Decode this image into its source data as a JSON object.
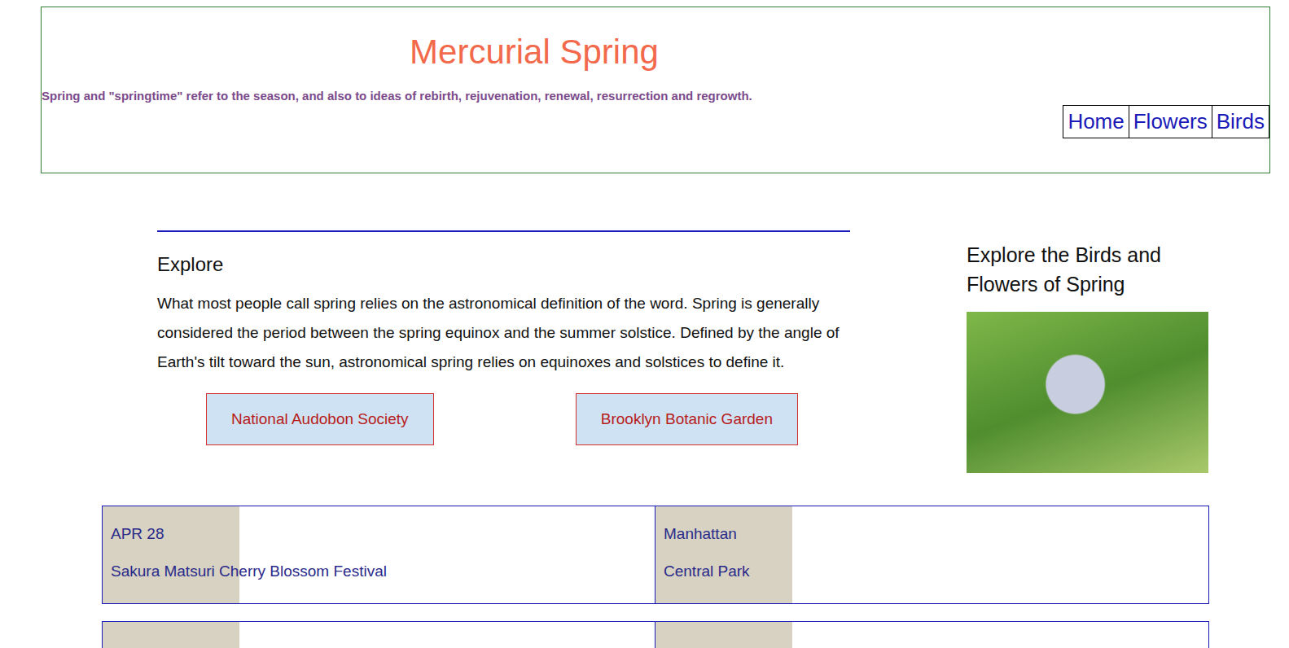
{
  "header": {
    "title": "Mercurial Spring",
    "tagline": "Spring and \"springtime\" refer to the season, and also to ideas of rebirth, rejuvenation, renewal, resurrection and regrowth."
  },
  "nav": [
    {
      "label": "Home"
    },
    {
      "label": "Flowers"
    },
    {
      "label": "Birds"
    }
  ],
  "explore": {
    "heading": "Explore",
    "body": "What most people call spring relies on the astronomical definition of the word. Spring is generally considered the period between the spring equinox and the summer solstice. Defined by the angle of Earth's tilt toward the sun, astronomical spring relies on equinoxes and solstices to define it.",
    "buttons": [
      "National Audobon Society",
      "Brooklyn Botanic Garden"
    ]
  },
  "aside": {
    "heading": "Explore the Birds and Flowers of Spring"
  },
  "cards": [
    {
      "lines": [
        "APR 28",
        "Sakura Matsuri Cherry Blossom Festival"
      ]
    },
    {
      "lines": [
        "Manhattan",
        "Central Park"
      ]
    },
    {
      "lines": []
    },
    {
      "lines": []
    }
  ]
}
